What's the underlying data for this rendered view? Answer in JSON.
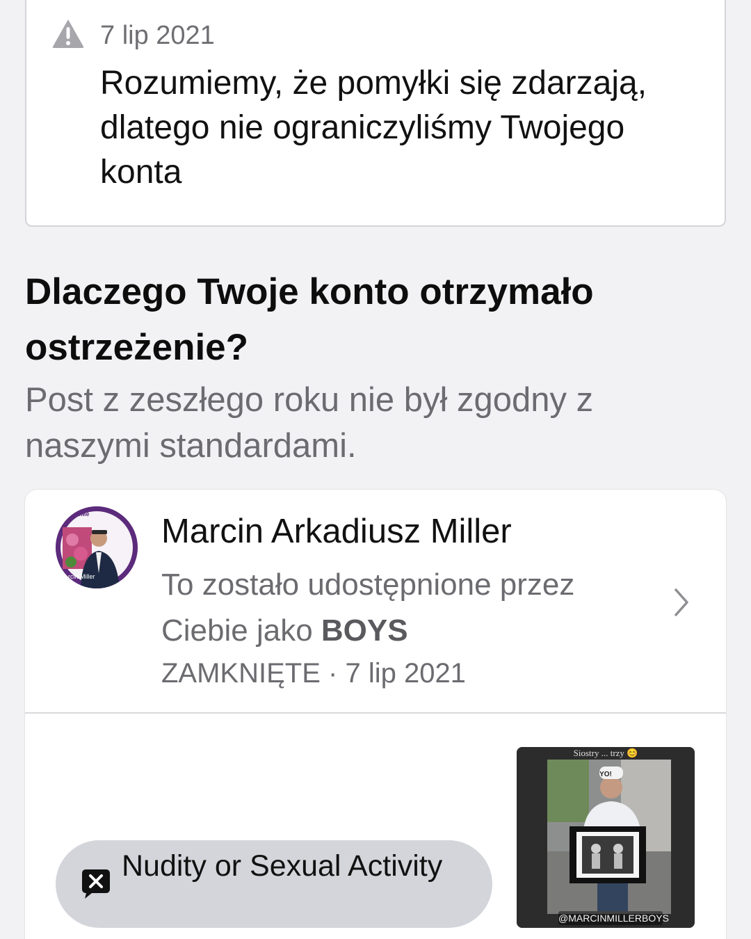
{
  "notice": {
    "date": "7 lip 2021",
    "message": "Rozumiemy, że pomyłki się zdarzają, dlatego nie ograniczyliśmy Twojego konta"
  },
  "section": {
    "title": "Dlaczego Twoje konto otrzymało ostrzeżenie?",
    "subtitle": "Post z zeszłego roku nie był zgodny z naszymi standardami."
  },
  "post": {
    "author": "Marcin Arkadiusz Miller",
    "shared_prefix": "To zostało udostępnione przez Ciebie jako ",
    "shared_as": "BOYS",
    "status": "ZAMKNIĘTE · 7 lip 2021",
    "avatar_overlay": "HypeMe",
    "avatar_name": "rcin Miller",
    "tag_label": "Nudity or Sexual Activity",
    "thumbnail": {
      "caption": "Siostry ... trzy 😊",
      "handle": "@MARCINMILLERBOYS",
      "cap_text": "YO!"
    }
  },
  "icons": {
    "warning": "warning-icon",
    "chevron": "chevron-right-icon",
    "tag": "close-speech-icon"
  }
}
